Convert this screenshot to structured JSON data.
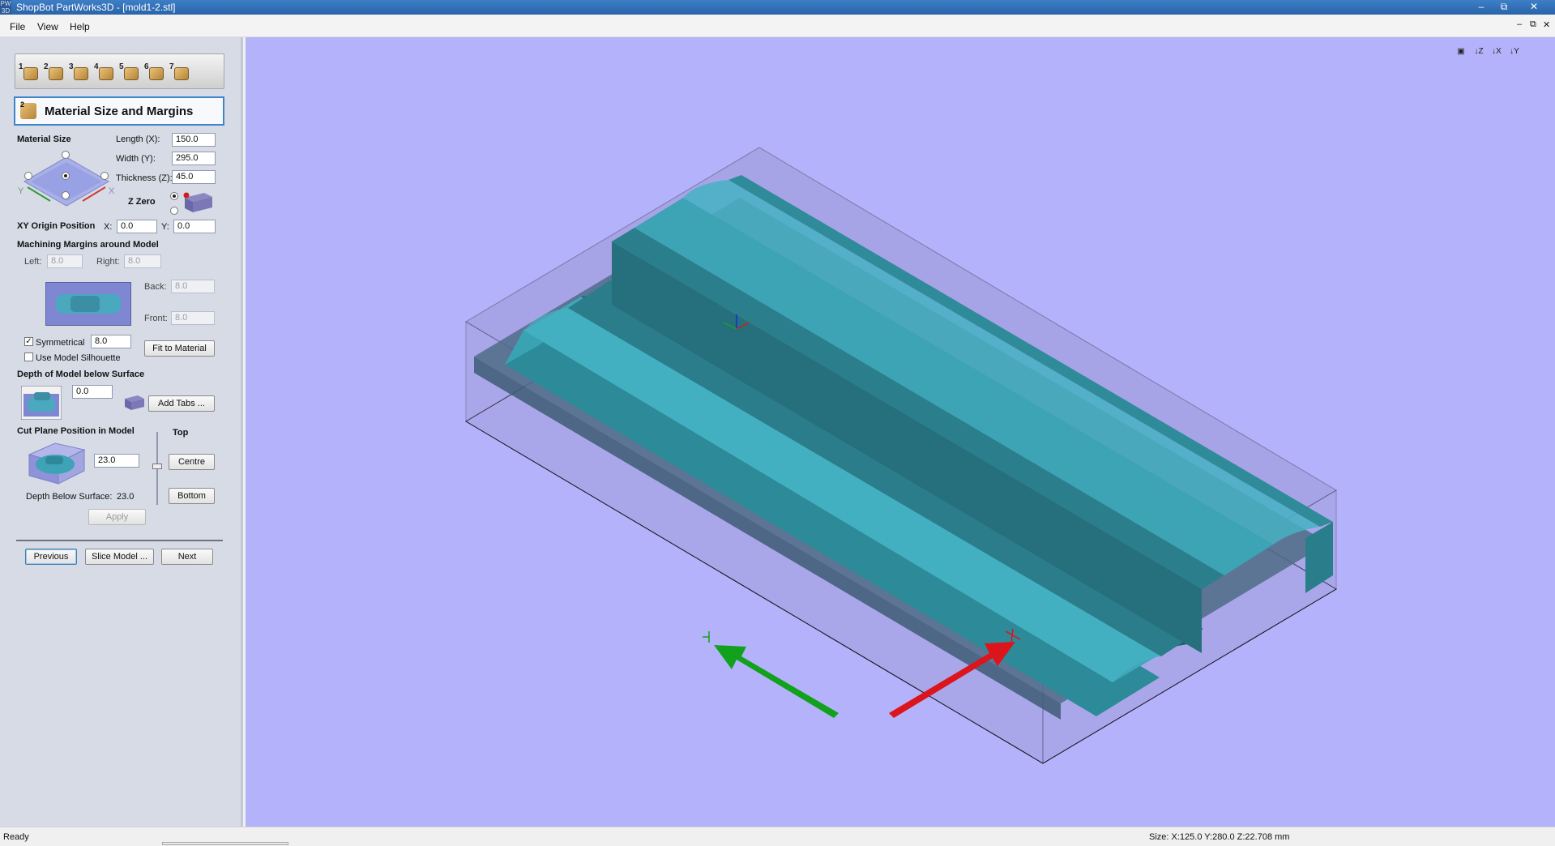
{
  "window": {
    "title": "ShopBot PartWorks3D - [mold1-2.stl]",
    "app_icon_text": "PW 3D",
    "min_label": "–",
    "max_label": "⧉",
    "close_label": "✕"
  },
  "menu": {
    "items": [
      "File",
      "View",
      "Help"
    ],
    "mdi_min": "–",
    "mdi_restore": "⧉",
    "mdi_close": "✕"
  },
  "wizard": {
    "steps": [
      "1",
      "2",
      "3",
      "4",
      "5",
      "6",
      "7"
    ],
    "section_number": "2",
    "section_title": "Material Size and Margins"
  },
  "material": {
    "heading": "Material Size",
    "length_label": "Length (X):",
    "length_value": "150.0",
    "width_label": "Width (Y):",
    "width_value": "295.0",
    "thickness_label": "Thickness (Z):",
    "thickness_value": "45.0",
    "axis_x": "X",
    "axis_y": "Y",
    "z_zero_label": "Z Zero"
  },
  "origin": {
    "heading": "XY Origin Position",
    "x_label": "X:",
    "x_value": "0.0",
    "y_label": "Y:",
    "y_value": "0.0"
  },
  "margins": {
    "heading": "Machining Margins around Model",
    "left_label": "Left:",
    "left_value": "8.0",
    "right_label": "Right:",
    "right_value": "8.0",
    "back_label": "Back:",
    "back_value": "8.0",
    "front_label": "Front:",
    "front_value": "8.0",
    "symmetrical_label": "Symmetrical",
    "symmetrical_checked": true,
    "symmetrical_value": "8.0",
    "silhouette_label": "Use Model Silhouette",
    "silhouette_checked": false,
    "fit_button": "Fit to Material"
  },
  "depth": {
    "heading": "Depth of Model below Surface",
    "value": "0.0",
    "add_tabs_button": "Add Tabs ..."
  },
  "cutplane": {
    "heading": "Cut Plane Position in Model",
    "top_label": "Top",
    "value": "23.0",
    "centre_button": "Centre",
    "bottom_button": "Bottom",
    "depth_below_label": "Depth Below Surface:",
    "depth_below_value": "23.0",
    "apply_button": "Apply"
  },
  "nav": {
    "previous": "Previous",
    "slice": "Slice Model ...",
    "next": "Next"
  },
  "view_icons": [
    "iso-view-icon",
    "z-view-icon",
    "x-view-icon",
    "y-view-icon"
  ],
  "view_icon_labels": [
    "▣",
    "↓Z",
    "↓X",
    "↓Y"
  ],
  "status": {
    "text": "Ready",
    "size": "Size: X:125.0 Y:280.0 Z:22.708 mm"
  },
  "colors": {
    "viewport_bg": "#b4b2fa",
    "model": "#2f8f9e",
    "x_arrow": "#e0141e",
    "y_arrow": "#14a21e"
  }
}
